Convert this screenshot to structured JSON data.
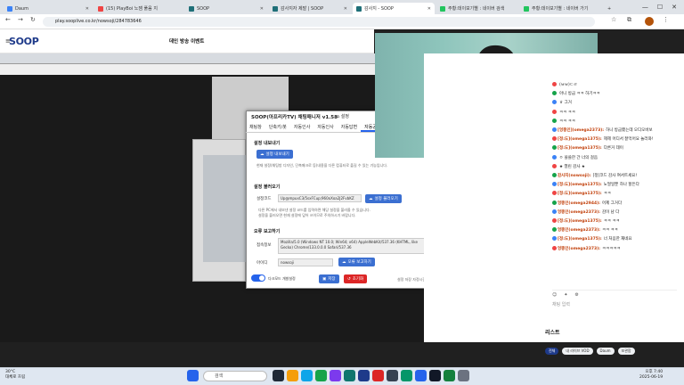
{
  "browser": {
    "tabs": [
      {
        "label": "Daum",
        "color": "#3b82f6"
      },
      {
        "label": "(15) PlayBoi 노잼 풀음 지",
        "color": "#ef4444"
      },
      {
        "label": "SOOP",
        "color": "#1f6f78"
      },
      {
        "label": "감사지자 제발 | SOOP",
        "color": "#1f6f78"
      },
      {
        "label": "감사지 - SOOP",
        "color": "#1f6f78"
      },
      {
        "label": "주황:데이보기별 : 네이버 검색",
        "color": "#22c55e"
      },
      {
        "label": "주황:데이보기별 : 네이버 가기",
        "color": "#22c55e"
      }
    ],
    "url": "play.sooplive.co.kr/nowsoji/284783646"
  },
  "soop": {
    "logo": "SOOP",
    "live_title": "데인 방송 이벤트"
  },
  "dialog": {
    "title": "SOOP(아프리카TV) 채팅매니저 v1.58",
    "home": "설정",
    "tabs": [
      "채팅창",
      "단축키/봇",
      "자동인사",
      "자동인사",
      "자동답변",
      "자동공지",
      "제"
    ],
    "export_section": "설정 내보내기",
    "export_button": "설정 내보내기",
    "export_note": "현재 설정(채팅방 디자인, 단축매크로 등)내용을 다른 컴퓨터로 옮길 수 있는 기능입니다.",
    "import_section": "설정 불러오기",
    "import_label": "설정코드",
    "import_value": "Up@mpuxC3/5sxFCup;960oXoa2J2FvbKZ",
    "import_button": "설정 불러오기",
    "import_note1": "다른 PC에서 내보낸 설정 코드를 입력하면 해당 설정을 불러올 수 있습니다.",
    "import_note2": "설정을 불러오면 현재 설정에 덮어 쓰이므로 주의하시기 바랍니다.",
    "error_section": "오류 보고하기",
    "error_browser_label": "접속정보",
    "error_browser_value": "Mozilla/5.0 (Windows NT 10.0; Win64; x64) AppleWebKit/537.36 (KHTML, like Gecko) Chrome/133.0.0.0 Safari/537.36",
    "error_id_label": "아이디",
    "error_id_value": "nowsoji",
    "error_button": "오류 보고하기",
    "toggle_label": "다크모드 개발설정",
    "save_button": "저장",
    "delete_button": "초기화",
    "footer_note": "설정 저장 자정시간"
  },
  "chat": {
    "rows": [
      {
        "nick": "",
        "text": "(ㅂㅂ)ㄷㄹ"
      },
      {
        "nick": "",
        "text": "아니 방금 ㅋㅋ 하기ㅋㅋ"
      },
      {
        "nick": "",
        "text": "ㅎ 그거"
      },
      {
        "nick": "",
        "text": "ㅋㅋ ㅋㅋ"
      },
      {
        "nick": "",
        "text": "ㅋㅋ ㅋㅋ"
      },
      {
        "nick": "[엉뚱인](omega2373):",
        "text": "하니 방금했는데 오디오바보"
      },
      {
        "nick": "[정:도](omega1375):",
        "text": "헤헤 어디서 잘먹어요 놀러와!"
      },
      {
        "nick": "[정:도](omega1375):",
        "text": "다른거 데이"
      },
      {
        "nick": "",
        "text": "ㅇ 쓸쓸한 간 너의 걸음"
      },
      {
        "nick": "",
        "text": "★ 열린 감사 ★"
      },
      {
        "nick": "감사지(nowsoji):",
        "text": "[정]코드 감사 여서트세요!"
      },
      {
        "nick": "[정:도](omega1375):",
        "text": "노멀일뿐 하나 할든다"
      },
      {
        "nick": "[정:도](omega1375):",
        "text": "ㅋㅋ"
      },
      {
        "nick": "엉뚱인(omega2944):",
        "text": "어제 그거다"
      },
      {
        "nick": "엉뚱인(omega2373):",
        "text": "감이 남 다"
      },
      {
        "nick": "[정:도](omega1375):",
        "text": "ㅋㅋ ㅋㅋ"
      },
      {
        "nick": "엉뚱인(omega2373):",
        "text": "ㅋㅋ ㅋㅋ"
      },
      {
        "nick": "[정:도](omega1375):",
        "text": "너 처음한 재네요"
      },
      {
        "nick": "엉뚱인(omega2373):",
        "text": "ㅋㅋㅋㅋㅋ"
      }
    ],
    "input_placeholder": "채팅 입력",
    "list_title": "리스트",
    "list_tabs": [
      "전체",
      "내 라이브 VOD",
      "Daum",
      "보관함"
    ]
  },
  "taskbar": {
    "temp": "30°C",
    "weather": "대체로 흐림",
    "search_placeholder": "검색",
    "time": "오후 7:40",
    "date": "2025-06-19"
  }
}
